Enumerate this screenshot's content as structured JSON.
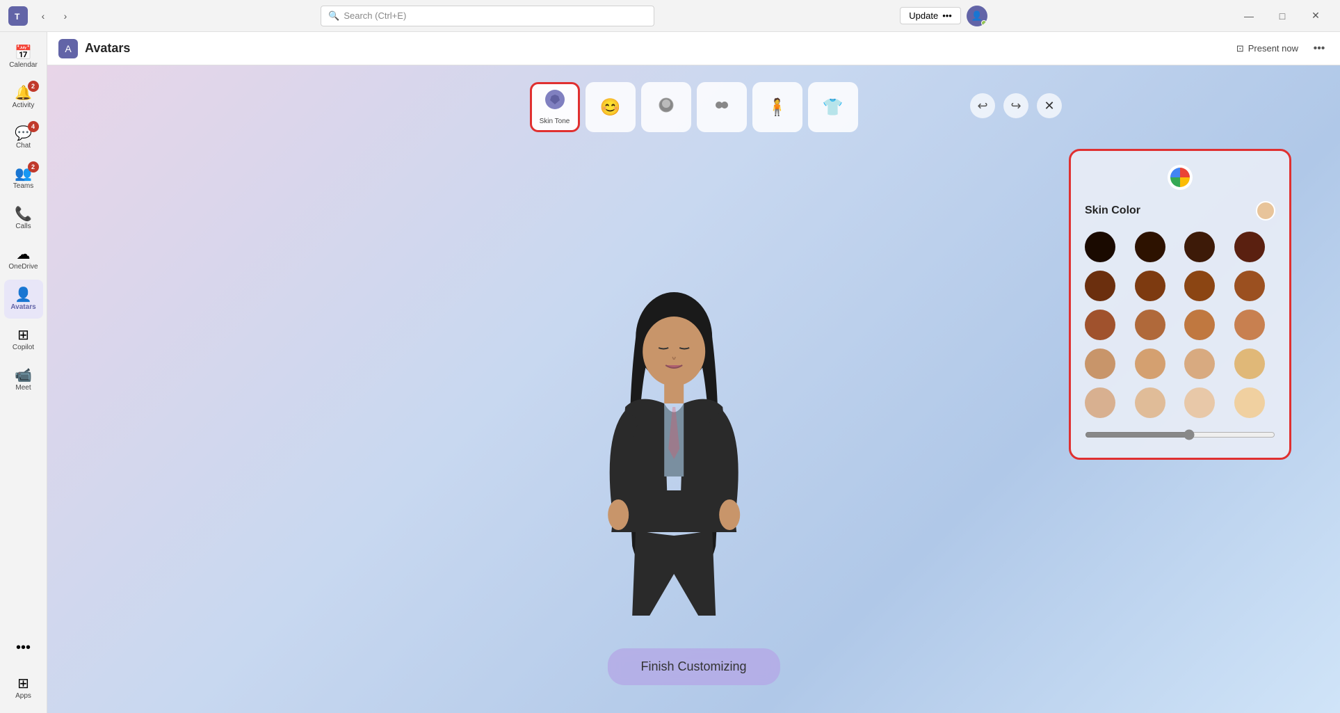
{
  "titlebar": {
    "teams_logo": "T",
    "search_placeholder": "Search (Ctrl+E)",
    "update_label": "Update",
    "update_dots": "•••",
    "minimize": "—",
    "maximize": "□",
    "close": "✕"
  },
  "sidebar": {
    "items": [
      {
        "id": "calendar",
        "label": "Calendar",
        "icon": "📅",
        "badge": null,
        "active": false
      },
      {
        "id": "activity",
        "label": "Activity",
        "icon": "🔔",
        "badge": "2",
        "active": false
      },
      {
        "id": "chat",
        "label": "Chat",
        "icon": "💬",
        "badge": "4",
        "active": false
      },
      {
        "id": "teams",
        "label": "Teams",
        "icon": "👥",
        "badge": "2",
        "active": false
      },
      {
        "id": "calls",
        "label": "Calls",
        "icon": "📞",
        "badge": null,
        "active": false
      },
      {
        "id": "onedrive",
        "label": "OneDrive",
        "icon": "☁",
        "badge": null,
        "active": false
      },
      {
        "id": "avatars",
        "label": "Avatars",
        "icon": "👤",
        "badge": null,
        "active": true
      },
      {
        "id": "copilot",
        "label": "Copilot",
        "icon": "⊞",
        "badge": null,
        "active": false
      },
      {
        "id": "meet",
        "label": "Meet",
        "icon": "📹",
        "badge": null,
        "active": false
      },
      {
        "id": "more",
        "label": "•••",
        "icon": "•••",
        "badge": null,
        "active": false
      },
      {
        "id": "apps",
        "label": "Apps",
        "icon": "⊞",
        "badge": null,
        "active": false
      }
    ]
  },
  "content_header": {
    "app_icon": "A",
    "title": "Avatars",
    "present_now_label": "Present now",
    "more_icon": "•••"
  },
  "category_toolbar": {
    "items": [
      {
        "id": "skin-tone",
        "label": "Skin Tone",
        "icon": "🎨",
        "active": true
      },
      {
        "id": "face",
        "label": "",
        "icon": "😊",
        "active": false
      },
      {
        "id": "hair",
        "label": "",
        "icon": "👤",
        "active": false
      },
      {
        "id": "features",
        "label": "",
        "icon": "👥",
        "active": false
      },
      {
        "id": "body",
        "label": "",
        "icon": "🧍",
        "active": false
      },
      {
        "id": "outfit",
        "label": "",
        "icon": "👕",
        "active": false
      }
    ]
  },
  "toolbar_actions": {
    "undo_icon": "↩",
    "redo_icon": "↪",
    "close_icon": "✕"
  },
  "finish_button": {
    "label": "Finish Customizing"
  },
  "skin_panel": {
    "title": "Skin Color",
    "current_color": "#e8c49a",
    "colors": [
      {
        "hex": "#1a0a00",
        "row": 0,
        "col": 0
      },
      {
        "hex": "#2d1200",
        "row": 0,
        "col": 1
      },
      {
        "hex": "#3d1a08",
        "row": 0,
        "col": 2
      },
      {
        "hex": "#5a2010",
        "row": 0,
        "col": 3
      },
      {
        "hex": "#6b2f0e",
        "row": 1,
        "col": 0
      },
      {
        "hex": "#7d3a10",
        "row": 1,
        "col": 1
      },
      {
        "hex": "#8b4513",
        "row": 1,
        "col": 2
      },
      {
        "hex": "#9b5020",
        "row": 1,
        "col": 3
      },
      {
        "hex": "#a0522d",
        "row": 2,
        "col": 0
      },
      {
        "hex": "#b0693a",
        "row": 2,
        "col": 1
      },
      {
        "hex": "#c07840",
        "row": 2,
        "col": 2
      },
      {
        "hex": "#c88050",
        "row": 2,
        "col": 3
      },
      {
        "hex": "#c8956a",
        "row": 3,
        "col": 0
      },
      {
        "hex": "#d4a070",
        "row": 3,
        "col": 1
      },
      {
        "hex": "#d8aa80",
        "row": 3,
        "col": 2
      },
      {
        "hex": "#e0b878",
        "row": 3,
        "col": 3
      },
      {
        "hex": "#d8b090",
        "row": 4,
        "col": 0
      },
      {
        "hex": "#e0bc98",
        "row": 4,
        "col": 1
      },
      {
        "hex": "#e8c8a8",
        "row": 4,
        "col": 2
      },
      {
        "hex": "#f0d0a0",
        "row": 4,
        "col": 3
      }
    ],
    "slider_value": 55
  }
}
